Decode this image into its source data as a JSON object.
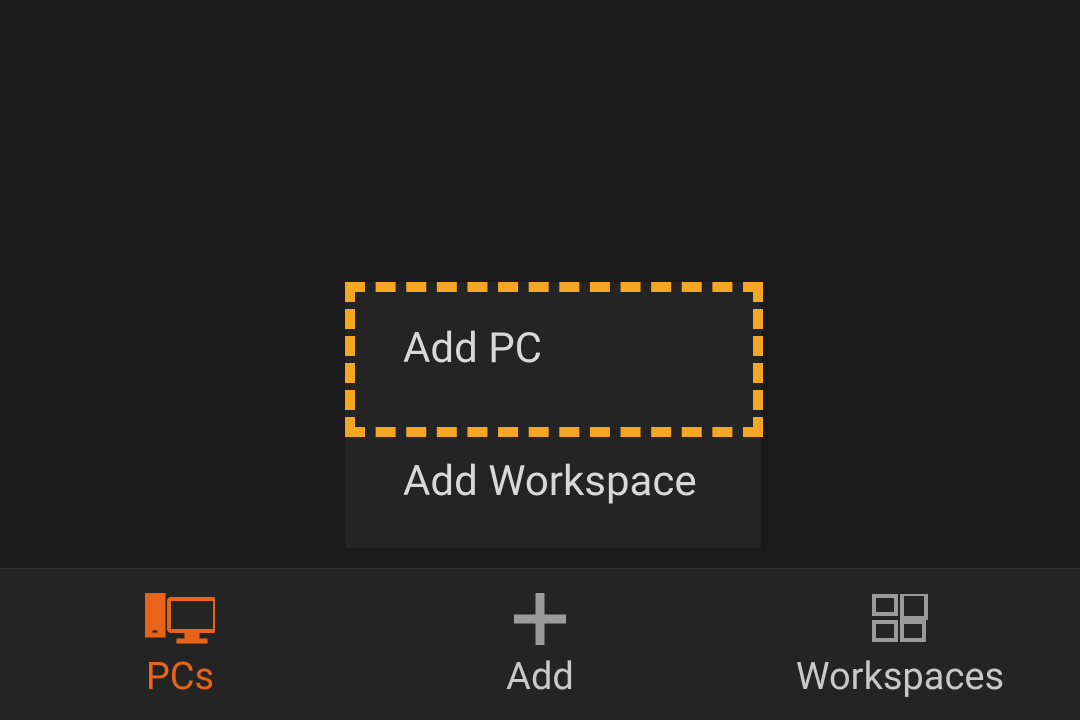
{
  "popup": {
    "items": [
      {
        "label": "Add PC"
      },
      {
        "label": "Add Workspace"
      }
    ]
  },
  "bottomNav": {
    "pcs": {
      "label": "PCs"
    },
    "add": {
      "label": "Add"
    },
    "workspaces": {
      "label": "Workspaces"
    }
  },
  "colors": {
    "accent": "#e8641a",
    "highlight": "#f5a623",
    "background": "#1a1a1a",
    "surface": "#242424",
    "textPrimary": "#d8d8d8",
    "textSecondary": "#9a9a9a"
  }
}
